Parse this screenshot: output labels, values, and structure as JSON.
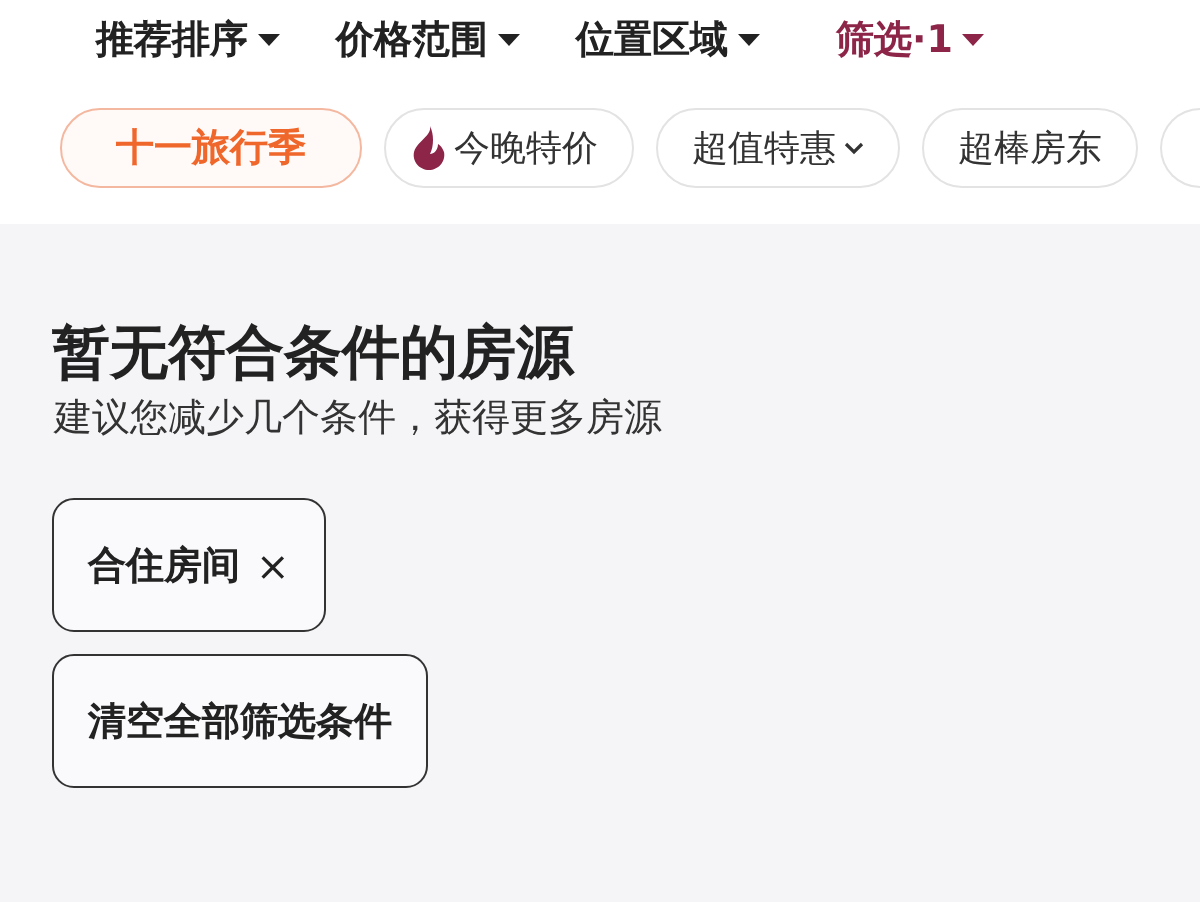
{
  "sort_bar": [
    {
      "label": "推荐排序",
      "active": false
    },
    {
      "label": "价格范围",
      "active": false
    },
    {
      "label": "位置区域",
      "active": false
    },
    {
      "label": "筛选·1",
      "active": true
    }
  ],
  "chips": [
    {
      "kind": "promo",
      "label": "十一旅行季"
    },
    {
      "kind": "flame",
      "label": "今晚特价"
    },
    {
      "kind": "dropdown",
      "label": "超值特惠"
    },
    {
      "kind": "plain",
      "label": "超棒房东"
    }
  ],
  "empty_state": {
    "title": "暂无符合条件的房源",
    "subtitle": "建议您减少几个条件，获得更多房源"
  },
  "active_filters": [
    {
      "label": "合住房间",
      "remove": "×"
    }
  ],
  "clear_button": "清空全部筛选条件"
}
